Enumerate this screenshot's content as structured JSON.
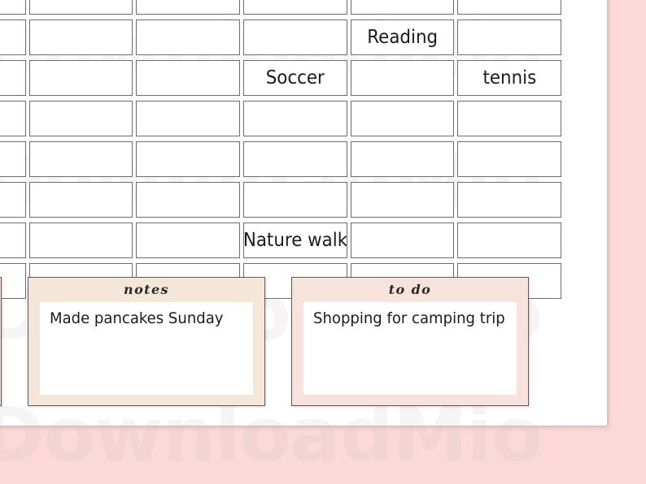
{
  "page": {
    "kind": "weekly-planner-sheet",
    "background_color": "#fbd9da",
    "sheet_color": "#ffffff",
    "watermark_text": "DownloadMio"
  },
  "grid": {
    "columns": 6,
    "rows": 8,
    "cell_border_color": "#6c6c6c",
    "entries": [
      {
        "row": 1,
        "col": 1,
        "text": ""
      },
      {
        "row": 1,
        "col": 2,
        "text": ""
      },
      {
        "row": 1,
        "col": 3,
        "text": ""
      },
      {
        "row": 1,
        "col": 4,
        "text": ""
      },
      {
        "row": 1,
        "col": 5,
        "text": ""
      },
      {
        "row": 1,
        "col": 6,
        "text": ""
      },
      {
        "row": 2,
        "col": 1,
        "text": ""
      },
      {
        "row": 2,
        "col": 2,
        "text": ""
      },
      {
        "row": 2,
        "col": 3,
        "text": ""
      },
      {
        "row": 2,
        "col": 4,
        "text": ""
      },
      {
        "row": 2,
        "col": 5,
        "text": "Reading"
      },
      {
        "row": 2,
        "col": 6,
        "text": ""
      },
      {
        "row": 3,
        "col": 1,
        "text": ""
      },
      {
        "row": 3,
        "col": 2,
        "text": ""
      },
      {
        "row": 3,
        "col": 3,
        "text": ""
      },
      {
        "row": 3,
        "col": 4,
        "text": "Soccer"
      },
      {
        "row": 3,
        "col": 5,
        "text": ""
      },
      {
        "row": 3,
        "col": 6,
        "text": "tennis"
      },
      {
        "row": 4,
        "col": 1,
        "text": ""
      },
      {
        "row": 4,
        "col": 2,
        "text": ""
      },
      {
        "row": 4,
        "col": 3,
        "text": ""
      },
      {
        "row": 4,
        "col": 4,
        "text": ""
      },
      {
        "row": 4,
        "col": 5,
        "text": ""
      },
      {
        "row": 4,
        "col": 6,
        "text": ""
      },
      {
        "row": 5,
        "col": 1,
        "text": ""
      },
      {
        "row": 5,
        "col": 2,
        "text": ""
      },
      {
        "row": 5,
        "col": 3,
        "text": ""
      },
      {
        "row": 5,
        "col": 4,
        "text": ""
      },
      {
        "row": 5,
        "col": 5,
        "text": ""
      },
      {
        "row": 5,
        "col": 6,
        "text": ""
      },
      {
        "row": 6,
        "col": 1,
        "text": ""
      },
      {
        "row": 6,
        "col": 2,
        "text": ""
      },
      {
        "row": 6,
        "col": 3,
        "text": ""
      },
      {
        "row": 6,
        "col": 4,
        "text": ""
      },
      {
        "row": 6,
        "col": 5,
        "text": ""
      },
      {
        "row": 6,
        "col": 6,
        "text": ""
      },
      {
        "row": 7,
        "col": 1,
        "text": ""
      },
      {
        "row": 7,
        "col": 2,
        "text": ""
      },
      {
        "row": 7,
        "col": 3,
        "text": ""
      },
      {
        "row": 7,
        "col": 4,
        "text": "Nature walk"
      },
      {
        "row": 7,
        "col": 5,
        "text": ""
      },
      {
        "row": 7,
        "col": 6,
        "text": ""
      },
      {
        "row": 8,
        "col": 1,
        "text": ""
      },
      {
        "row": 8,
        "col": 2,
        "text": ""
      },
      {
        "row": 8,
        "col": 3,
        "text": ""
      },
      {
        "row": 8,
        "col": 4,
        "text": ""
      },
      {
        "row": 8,
        "col": 5,
        "text": ""
      },
      {
        "row": 8,
        "col": 6,
        "text": ""
      }
    ]
  },
  "bottom_boxes": [
    {
      "title": "",
      "tone": "tone-rose",
      "accent_color": "#fadcdc",
      "lines": []
    },
    {
      "title": "notes",
      "tone": "tone-cream",
      "accent_color": "#f5e6da",
      "lines": [
        "Made pancakes Sunday"
      ]
    },
    {
      "title": "to do",
      "tone": "tone-blush",
      "accent_color": "#f7e2dc",
      "lines": [
        "Shopping for camping trip"
      ]
    }
  ]
}
